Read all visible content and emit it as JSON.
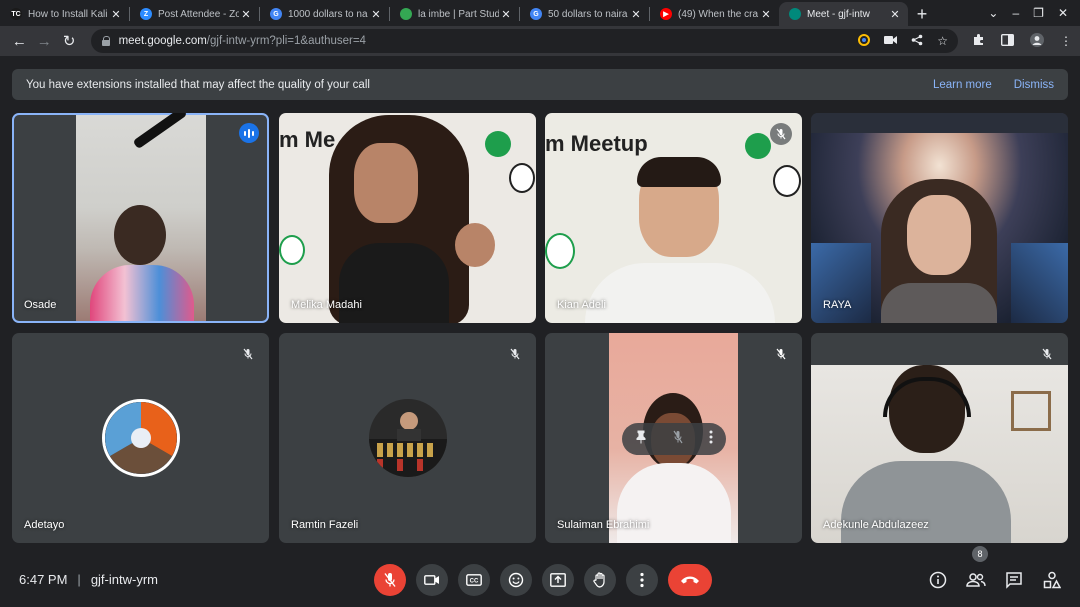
{
  "browser": {
    "tabs": [
      {
        "title": "How to Install Kali",
        "favicon_color": "#1a1a1a",
        "favicon_text": "TC",
        "active": false
      },
      {
        "title": "Post Attendee - Zo",
        "favicon_color": "#2d8cff",
        "favicon_text": "Z",
        "active": false
      },
      {
        "title": "1000 dollars to na",
        "favicon_color": "#4285f4",
        "favicon_text": "G",
        "active": false
      },
      {
        "title": "la imbe | Part Stud",
        "favicon_color": "#34a853",
        "favicon_text": "",
        "active": false
      },
      {
        "title": "50 dollars to naira",
        "favicon_color": "#4285f4",
        "favicon_text": "G",
        "active": false
      },
      {
        "title": "(49) When the cra",
        "favicon_color": "#ff0000",
        "favicon_text": "▶",
        "active": false
      },
      {
        "title": "Meet - gjf-intw",
        "favicon_color": "#00897b",
        "favicon_text": "",
        "active": true
      }
    ],
    "url_host": "meet.google.com",
    "url_path": "/gjf-intw-yrm?pli=1&authuser=4"
  },
  "banner": {
    "message": "You have extensions installed that may affect the quality of your call",
    "learn_more": "Learn more",
    "dismiss": "Dismiss"
  },
  "participants": [
    {
      "name": "Osade",
      "state": "speaking"
    },
    {
      "name": "Melika Madahi",
      "state": "unmuted"
    },
    {
      "name": "Kian Adeli",
      "state": "muted"
    },
    {
      "name": "RAYA",
      "state": "unmuted"
    },
    {
      "name": "Adetayo",
      "state": "muted",
      "avatar": true
    },
    {
      "name": "Ramtin Fazeli",
      "state": "muted",
      "avatar": true
    },
    {
      "name": "Sulaiman Ebrahimi",
      "state": "muted"
    },
    {
      "name": "Adekunle Abdulazeez",
      "state": "muted"
    }
  ],
  "tile_overlay": {
    "icons": [
      "pin-icon",
      "mic-off-icon",
      "more-vert-icon"
    ]
  },
  "meeting": {
    "time": "6:47 PM",
    "code": "gjf-intw-yrm",
    "participant_count": "8"
  },
  "colors": {
    "accent": "#8ab4f8",
    "danger": "#ea4335",
    "surface": "#3c4043",
    "background": "#202124"
  }
}
